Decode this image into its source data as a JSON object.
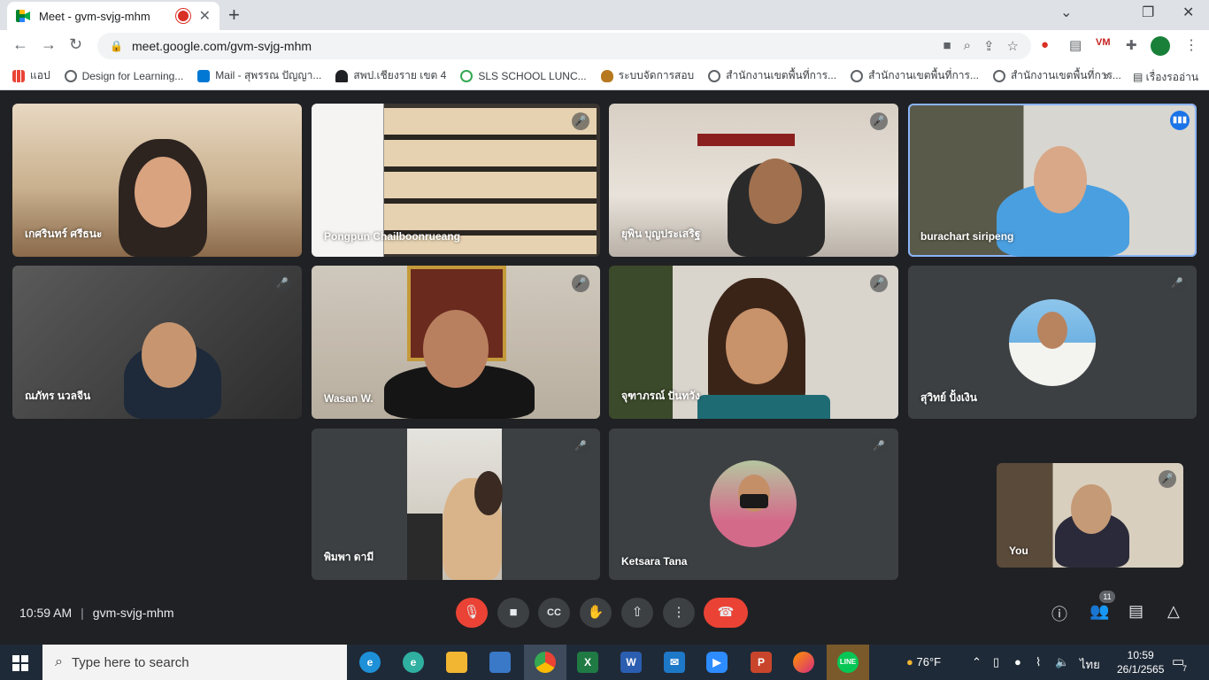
{
  "browser": {
    "tab_title": "Meet - gvm-svjg-mhm",
    "tab_close": "✕",
    "new_tab": "+",
    "url": "meet.google.com/gvm-svjg-mhm",
    "win_minimize": "⌄",
    "win_restore": "❐",
    "win_close": "✕"
  },
  "bookmarks": [
    {
      "label": "แอป",
      "color": "#ea4335"
    },
    {
      "label": "Design for Learning...",
      "color": "#5f6368"
    },
    {
      "label": "Mail - สุพรรณ ปัญญา...",
      "color": "#0078d4"
    },
    {
      "label": "สพป.เชียงราย เขต 4",
      "color": "#202124"
    },
    {
      "label": "SLS SCHOOL LUNC...",
      "color": "#34a853"
    },
    {
      "label": "ระบบจัดการสอบ",
      "color": "#b7791f"
    },
    {
      "label": "สำนักงานเขตพื้นที่การ...",
      "color": "#5f6368"
    },
    {
      "label": "สำนักงานเขตพื้นที่การ...",
      "color": "#5f6368"
    },
    {
      "label": "สำนักงานเขตพื้นที่การ...",
      "color": "#5f6368"
    }
  ],
  "bookmarks_more": "»",
  "reading_list": "เรื่องรออ่าน",
  "participants": [
    {
      "name": "เกศรินทร์ ศรีธนะ"
    },
    {
      "name": "Pongpun Chailboonrueang"
    },
    {
      "name": "ยุพิน บุญประเสริฐ"
    },
    {
      "name": "burachart siripeng"
    },
    {
      "name": "ณภัทร นวลจีน"
    },
    {
      "name": "Wasan W."
    },
    {
      "name": "จุฑาภรณ์ ปันทวัง"
    },
    {
      "name": "สุวิทย์ ปั้งเงิน"
    },
    {
      "name": "พิมพา ดามี"
    },
    {
      "name": "Ketsara Tana"
    },
    {
      "name": "You"
    }
  ],
  "meeting": {
    "time": "10:59 AM",
    "separator": "|",
    "code": "gvm-svjg-mhm",
    "participant_count": "11"
  },
  "taskbar": {
    "search_placeholder": "Type here to search",
    "weather": "76°F",
    "language": "ไทย",
    "clock_time": "10:59",
    "clock_date": "26/1/2565",
    "notifications": "7"
  },
  "colors": {
    "meet_bg": "#202124",
    "tile_bg": "#3c4043",
    "end_call": "#ea4335",
    "speaking": "#1a73e8"
  }
}
